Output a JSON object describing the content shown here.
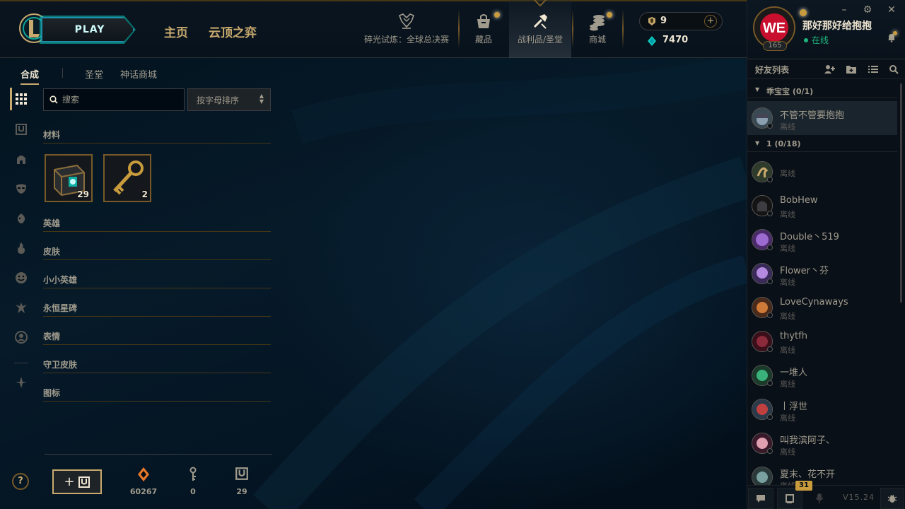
{
  "header": {
    "play_label": "PLAY",
    "home_label": "主页",
    "tft_label": "云顶之弈",
    "nav": {
      "event_label": "碎光试炼：全球总决赛",
      "collection_label": "藏品",
      "loot_label": "战利品/圣堂",
      "store_label": "商城"
    },
    "currency": {
      "rp": "9",
      "blue_essence": "7470"
    }
  },
  "profile": {
    "summoner_name": "那好那好给抱抱",
    "status": "在线",
    "level": "165"
  },
  "social": {
    "friends_title": "好友列表",
    "groups": [
      {
        "name": "乖宝宝 (0/1)",
        "friends": [
          {
            "name": "不管不管要抱抱",
            "status": "离线"
          }
        ]
      },
      {
        "name": "1 (0/18)",
        "friends": [
          {
            "name": "",
            "status": "离线"
          },
          {
            "name": "BobHew",
            "status": "离线"
          },
          {
            "name": "Double丶519",
            "status": "离线"
          },
          {
            "name": "Flower丶芬",
            "status": "离线"
          },
          {
            "name": "LoveCynaways",
            "status": "离线"
          },
          {
            "name": "thytfh",
            "status": "离线"
          },
          {
            "name": "一堆人",
            "status": "离线"
          },
          {
            "name": "丨浮世",
            "status": "离线"
          },
          {
            "name": "叫我滨阿子、",
            "status": "离线"
          },
          {
            "name": "夏末、花不开",
            "status": "离线"
          }
        ]
      }
    ],
    "footer": {
      "mission_count": "31",
      "version": "V15.24"
    }
  },
  "loot": {
    "tabs": {
      "craft": "合成",
      "sanctum": "圣堂",
      "mythic_shop": "神话商城"
    },
    "search": {
      "placeholder": "搜索"
    },
    "sort": {
      "value": "按字母排序"
    },
    "sections": {
      "materials": "材料",
      "champions": "英雄",
      "skins": "皮肤",
      "little_legends": "小小英雄",
      "eternals": "永恒星碑",
      "emotes": "表情",
      "ward_skins": "守卫皮肤",
      "icons": "图标"
    },
    "materials": [
      {
        "name": "hextech-chest",
        "count": "29"
      },
      {
        "name": "hextech-key",
        "count": "2"
      }
    ],
    "counters": {
      "orange_essence": "60267",
      "keys": "0",
      "chests": "29"
    }
  },
  "colors": {
    "gold": "#c8aa6e",
    "gold_dark": "#785a28",
    "teal": "#0ac8b9",
    "online_green": "#1fb57e",
    "background": "#010a13"
  }
}
